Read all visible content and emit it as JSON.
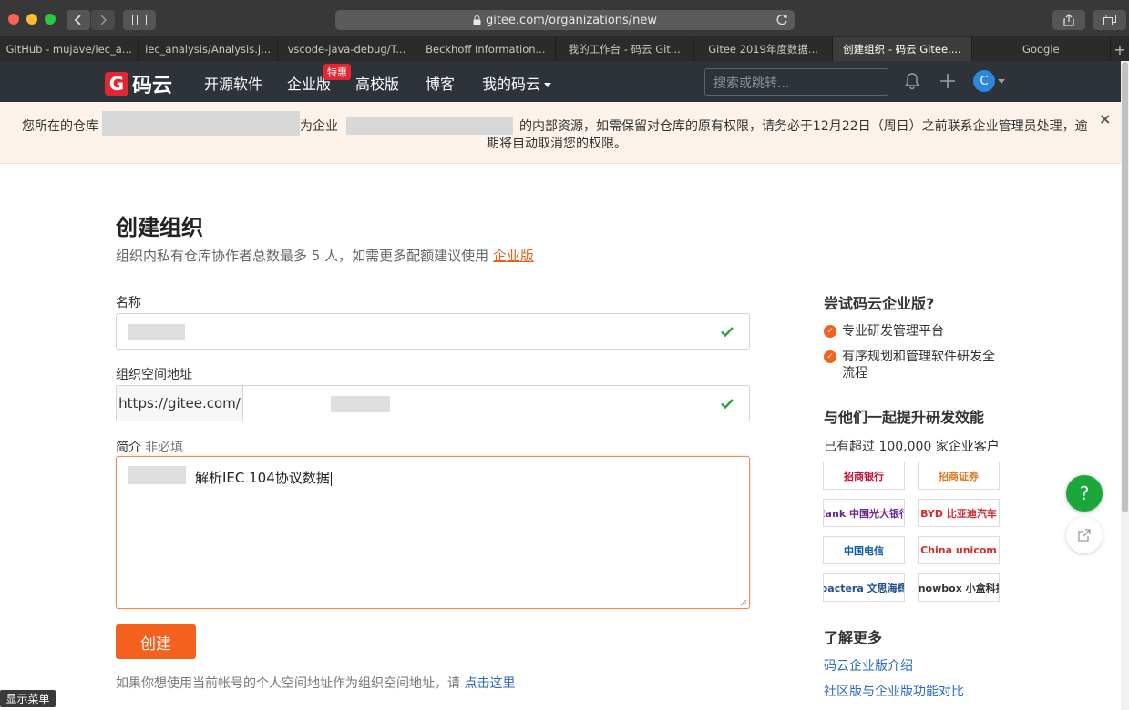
{
  "browser": {
    "url": "gitee.com/organizations/new",
    "tabs": [
      {
        "label": "GitHub - mujave/iec_a..."
      },
      {
        "label": "iec_analysis/Analysis.j..."
      },
      {
        "label": "vscode-java-debug/T..."
      },
      {
        "label": "Beckhoff Information..."
      },
      {
        "label": "我的工作台 - 码云 Git..."
      },
      {
        "label": "Gitee 2019年度数据..."
      },
      {
        "label": "创建组织 - 码云 Gitee...."
      },
      {
        "label": "Google"
      }
    ],
    "new_tab": "+"
  },
  "header": {
    "logo_mark": "G",
    "logo_text": "码云",
    "nav": {
      "open_source": "开源软件",
      "enterprise": "企业版",
      "enterprise_badge": "特惠",
      "university": "高校版",
      "blog": "博客",
      "my_gitee": "我的码云"
    },
    "search_placeholder": "搜索或跳转...",
    "avatar_initial": "C"
  },
  "notice": {
    "part1": "您所在的仓库",
    "part2": "为企业",
    "part3": "的内部资源，如需保留对仓库的原有权限，请务必于12月22日（周日）之前联系企业管理员处理，逾",
    "line2": "期将自动取消您的权限。",
    "close": "×"
  },
  "form": {
    "title": "创建组织",
    "subtitle": "组织内私有仓库协作者总数最多 5 人，如需更多配额建议使用 ",
    "subtitle_link": "企业版",
    "name_label": "名称",
    "path_label": "组织空间地址",
    "path_prefix": "https://gitee.com/",
    "desc_label": "简介",
    "desc_optional": "非必填",
    "desc_value": "解析IEC 104协议数据",
    "submit": "创建",
    "hint_text": "如果你想使用当前帐号的个人空间地址作为组织空间地址，请 ",
    "hint_link": "点击这里"
  },
  "sidebar": {
    "try_title": "尝试码云企业版?",
    "features": [
      {
        "label": "专业研发管理平台"
      },
      {
        "label": "有序规划和管理软件研发全流程"
      }
    ],
    "together_title": "与他们一起提升研发效能",
    "customers_text": "已有超过 100,000 家企业客户",
    "logos": [
      {
        "label": "招商银行",
        "color": "#c8102e"
      },
      {
        "label": "招商证券",
        "color": "#e07b22"
      },
      {
        "label": "Eank 中国光大银行",
        "color": "#6a2c91"
      },
      {
        "label": "BYD 比亚迪汽车",
        "color": "#d12a2f"
      },
      {
        "label": "中国电信",
        "color": "#0b59a8"
      },
      {
        "label": "China unicom",
        "color": "#d12a2f"
      },
      {
        "label": "pactera 文思海辉",
        "color": "#1f4e8c"
      },
      {
        "label": "knowbox 小盒科技",
        "color": "#333333"
      }
    ],
    "learn_title": "了解更多",
    "links": [
      {
        "label": "码云企业版介绍"
      },
      {
        "label": "社区版与企业版功能对比"
      }
    ]
  },
  "floating": {
    "help": "?"
  },
  "footer_menu": "显示菜单",
  "colors": {
    "accent": "#f4601d",
    "header_bg": "#2d3339",
    "notice_bg": "#fdf3eb",
    "link": "#2e6ac1",
    "success": "#1ba83a"
  }
}
